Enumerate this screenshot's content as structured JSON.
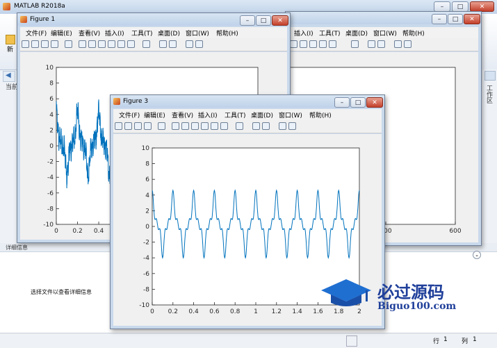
{
  "main_window": {
    "title": "MATLAB R2018a",
    "ribbon_labels": [
      "新",
      "当前"
    ],
    "side_panel_label": "工作区",
    "detail_header": "详细信息",
    "detail_message": "选择文件以查看详细信息"
  },
  "statusbar": {
    "row_label": "行",
    "row_value": "1",
    "col_label": "列",
    "col_value": "1"
  },
  "menus": [
    "文件(F)",
    "编辑(E)",
    "查看(V)",
    "插入(I)",
    "工具(T)",
    "桌面(D)",
    "窗口(W)",
    "帮助(H)"
  ],
  "back_window": {
    "visible_menus": [
      "插入(I)",
      "工具(T)",
      "桌面(D)",
      "窗口(W)",
      "帮助(H)"
    ]
  },
  "figures": {
    "figure1": {
      "title": "Figure 1"
    },
    "figure3": {
      "title": "Figure 3"
    }
  },
  "watermark": {
    "text": "必过源码",
    "subtext": "Biguo100.com"
  },
  "chart_data": [
    {
      "id": "figure1",
      "type": "line",
      "ylim": [
        -10,
        10
      ],
      "yticks": [
        -10,
        -8,
        -6,
        -4,
        -2,
        0,
        2,
        4,
        6,
        8,
        10
      ],
      "xticks_visible": [
        0,
        0.2,
        0.4
      ],
      "xtick_labels": [
        "0",
        "0.2",
        "0.4"
      ],
      "series_color": "#0072bd",
      "signal": "noisy periodic waveform, amplitude roughly -3 to 4, visible for x in [0, 0.55]"
    },
    {
      "id": "figure2",
      "type": "line",
      "xtick_labels_visible": [
        "500",
        "600"
      ],
      "xlim_visible": [
        430,
        600
      ],
      "series_color": "#0000ff",
      "signal": "dense marker band near y = -10 from x ≈ 430 to 490"
    },
    {
      "id": "figure3",
      "type": "line",
      "xlim": [
        0,
        2
      ],
      "ylim": [
        -10,
        10
      ],
      "xticks": [
        0,
        0.2,
        0.4,
        0.6,
        0.8,
        1,
        1.2,
        1.4,
        1.6,
        1.8,
        2
      ],
      "yticks": [
        -10,
        -8,
        -6,
        -4,
        -2,
        0,
        2,
        4,
        6,
        8,
        10
      ],
      "series_color": "#0072bd",
      "signal": "periodic waveform with period 0.2, peaks near 3.8, troughs near -2.4"
    }
  ]
}
